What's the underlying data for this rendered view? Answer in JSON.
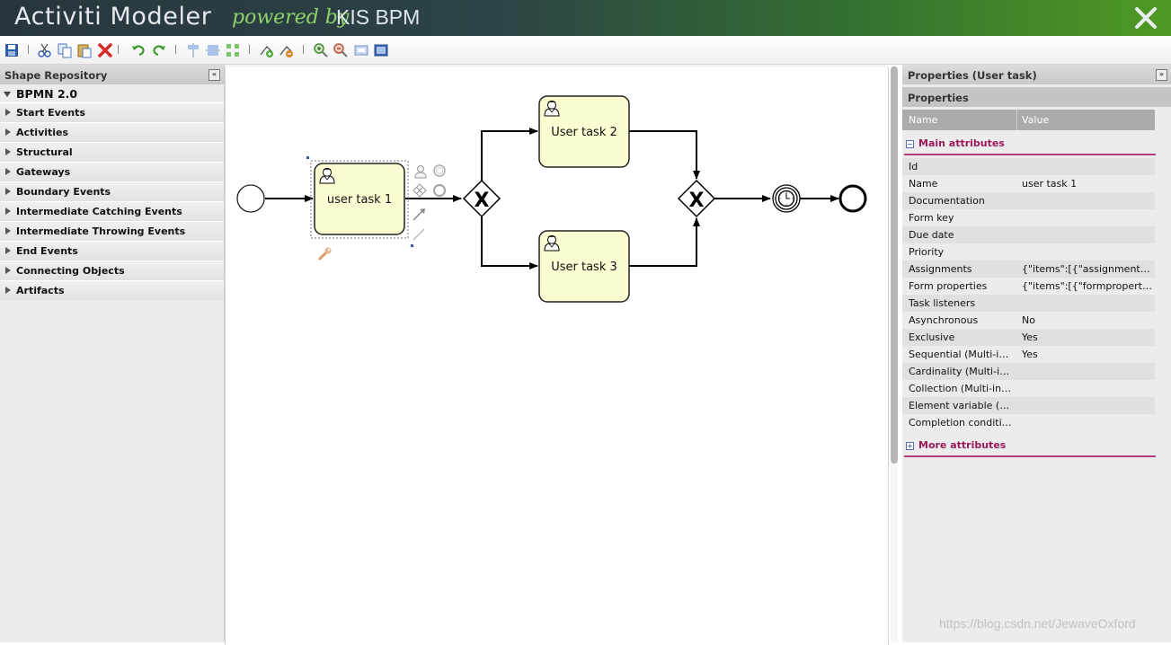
{
  "header": {
    "title": "Activiti Modeler",
    "powered_by": "powered by",
    "brand": "KIS BPM",
    "close_icon": "close-icon"
  },
  "toolbar": {
    "buttons": [
      "save-icon",
      "cut-icon",
      "copy-icon",
      "paste-icon",
      "delete-icon",
      "undo-icon",
      "redo-icon",
      "align-vertical-icon",
      "align-horizontal-icon",
      "same-size-icon",
      "add-bendpoint-icon",
      "remove-bendpoint-icon",
      "zoom-in-icon",
      "zoom-out-icon",
      "zoom-actual-icon",
      "zoom-fit-icon"
    ]
  },
  "shape_repository": {
    "title": "Shape Repository",
    "collapse": "«",
    "root": "BPMN 2.0",
    "categories": [
      "Start Events",
      "Activities",
      "Structural",
      "Gateways",
      "Boundary Events",
      "Intermediate Catching Events",
      "Intermediate Throwing Events",
      "End Events",
      "Connecting Objects",
      "Artifacts"
    ]
  },
  "diagram": {
    "tasks": [
      "user task 1",
      "User task 2",
      "User task 3"
    ],
    "gateway_symbol": "X"
  },
  "properties": {
    "title": "Properties (User task)",
    "collapse": "»",
    "subtitle": "Properties",
    "col_name": "Name",
    "col_value": "Value",
    "main_group": "Main attributes",
    "more_group": "More attributes",
    "rows": [
      {
        "name": "Id",
        "value": ""
      },
      {
        "name": "Name",
        "value": "user task 1"
      },
      {
        "name": "Documentation",
        "value": ""
      },
      {
        "name": "Form key",
        "value": ""
      },
      {
        "name": "Due date",
        "value": ""
      },
      {
        "name": "Priority",
        "value": ""
      },
      {
        "name": "Assignments",
        "value": "{\"items\":[{\"assignment_typ…"
      },
      {
        "name": "Form properties",
        "value": "{\"items\":[{\"formproperty_id\"…"
      },
      {
        "name": "Task listeners",
        "value": ""
      },
      {
        "name": "Asynchronous",
        "value": "No"
      },
      {
        "name": "Exclusive",
        "value": "Yes"
      },
      {
        "name": "Sequential (Multi-inst…",
        "value": "Yes"
      },
      {
        "name": "Cardinality (Multi-inst…",
        "value": ""
      },
      {
        "name": "Collection (Multi-inst…",
        "value": ""
      },
      {
        "name": "Element variable (Mu…",
        "value": ""
      },
      {
        "name": "Completion condition…",
        "value": ""
      }
    ]
  },
  "watermark": "https://blog.csdn.net/JewaveOxford",
  "colors": {
    "task_fill": "#fcfcd2",
    "accent_pink": "#9b1a55",
    "header_green": "#4f9a24"
  }
}
